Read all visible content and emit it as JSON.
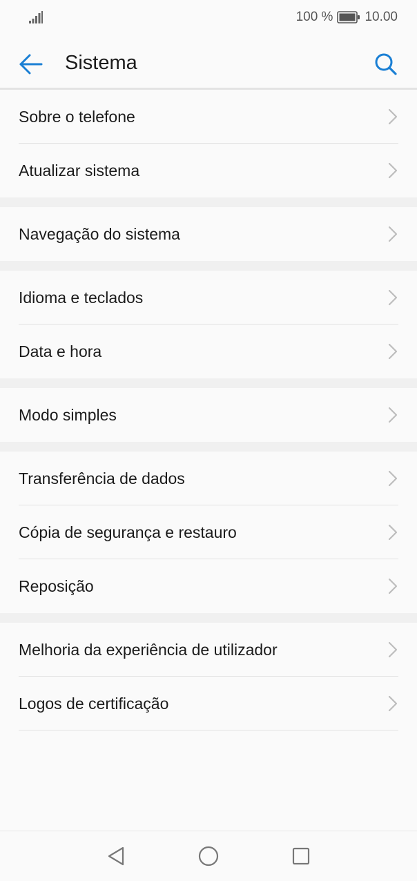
{
  "status_bar": {
    "battery_percent": "100 %",
    "time": "10.00",
    "icons": [
      "signal-icon",
      "battery-icon"
    ]
  },
  "app_bar": {
    "title": "Sistema",
    "back_icon": "arrow-left-icon",
    "search_icon": "search-icon"
  },
  "colors": {
    "accent": "#1a7fd4",
    "text": "#1b1b1b",
    "chevron": "#bdbdbd",
    "background": "#fafafa",
    "group_gap": "#f0f0f0"
  },
  "groups": [
    {
      "items": [
        {
          "label": "Sobre o telefone"
        },
        {
          "label": "Atualizar sistema"
        }
      ]
    },
    {
      "items": [
        {
          "label": "Navegação do sistema"
        }
      ]
    },
    {
      "items": [
        {
          "label": "Idioma e teclados"
        },
        {
          "label": "Data e hora"
        }
      ]
    },
    {
      "items": [
        {
          "label": "Modo simples"
        }
      ]
    },
    {
      "items": [
        {
          "label": "Transferência de dados"
        },
        {
          "label": "Cópia de segurança e restauro"
        },
        {
          "label": "Reposição"
        }
      ]
    },
    {
      "items": [
        {
          "label": "Melhoria da experiência de utilizador"
        },
        {
          "label": "Logos de certificação"
        }
      ]
    }
  ],
  "nav_bar": {
    "buttons": [
      "back-triangle-icon",
      "home-circle-icon",
      "recents-square-icon"
    ]
  }
}
